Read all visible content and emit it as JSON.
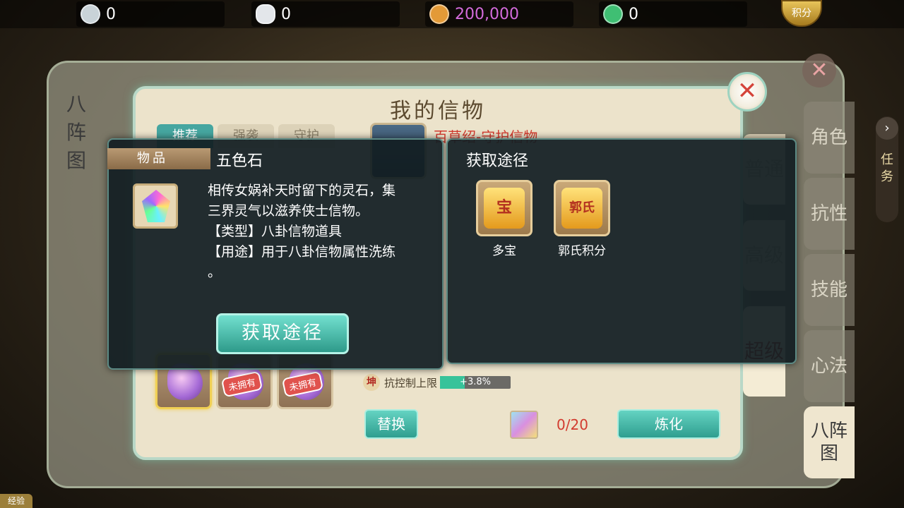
{
  "currencies": [
    {
      "icon": "silver-coin-icon",
      "value": "0"
    },
    {
      "icon": "silver-ingot-icon",
      "value": "0"
    },
    {
      "icon": "copper-coin-icon",
      "value": "200,000"
    },
    {
      "icon": "jade-add-icon",
      "value": "0"
    }
  ],
  "score_badge": "积分",
  "left_vertical_title": "八阵图",
  "side_tabs": [
    "角色",
    "抗性",
    "技能",
    "心法",
    "八阵图"
  ],
  "task_tab": "任务",
  "main": {
    "title": "我的信物",
    "tabs": [
      "推荐",
      "强袭",
      "守护"
    ],
    "detail_name": "百草绍-守护信物",
    "grid_badges": [
      "未拥有",
      "未拥有"
    ],
    "stats": [
      {
        "tag": "坤",
        "label": "抗控制上限",
        "bar_text": "+3.8%",
        "fill": 0.35
      }
    ],
    "replace_btn": "替换",
    "count": "0/20",
    "refine_btn": "炼化",
    "right_tabs": [
      "普通",
      "高级",
      "超级"
    ]
  },
  "item_popup": {
    "tag": "物品",
    "title": "五色石",
    "desc_lines": [
      "相传女娲补天时留下的灵石，集",
      "三界灵气以滋养侠士信物。",
      "【类型】八卦信物道具",
      "【用途】用于八卦信物属性洗练",
      "。"
    ],
    "button": "获取途径"
  },
  "source_popup": {
    "title": "获取途径",
    "sources": [
      {
        "label": "多宝",
        "glyph": "宝"
      },
      {
        "label": "郭氏积分",
        "glyph": "郭氏"
      }
    ]
  },
  "corner_label": "经验",
  "colors": {
    "teal": "#46a6a0",
    "red": "#d23b2f",
    "panel_bg": "#ece3cb"
  }
}
